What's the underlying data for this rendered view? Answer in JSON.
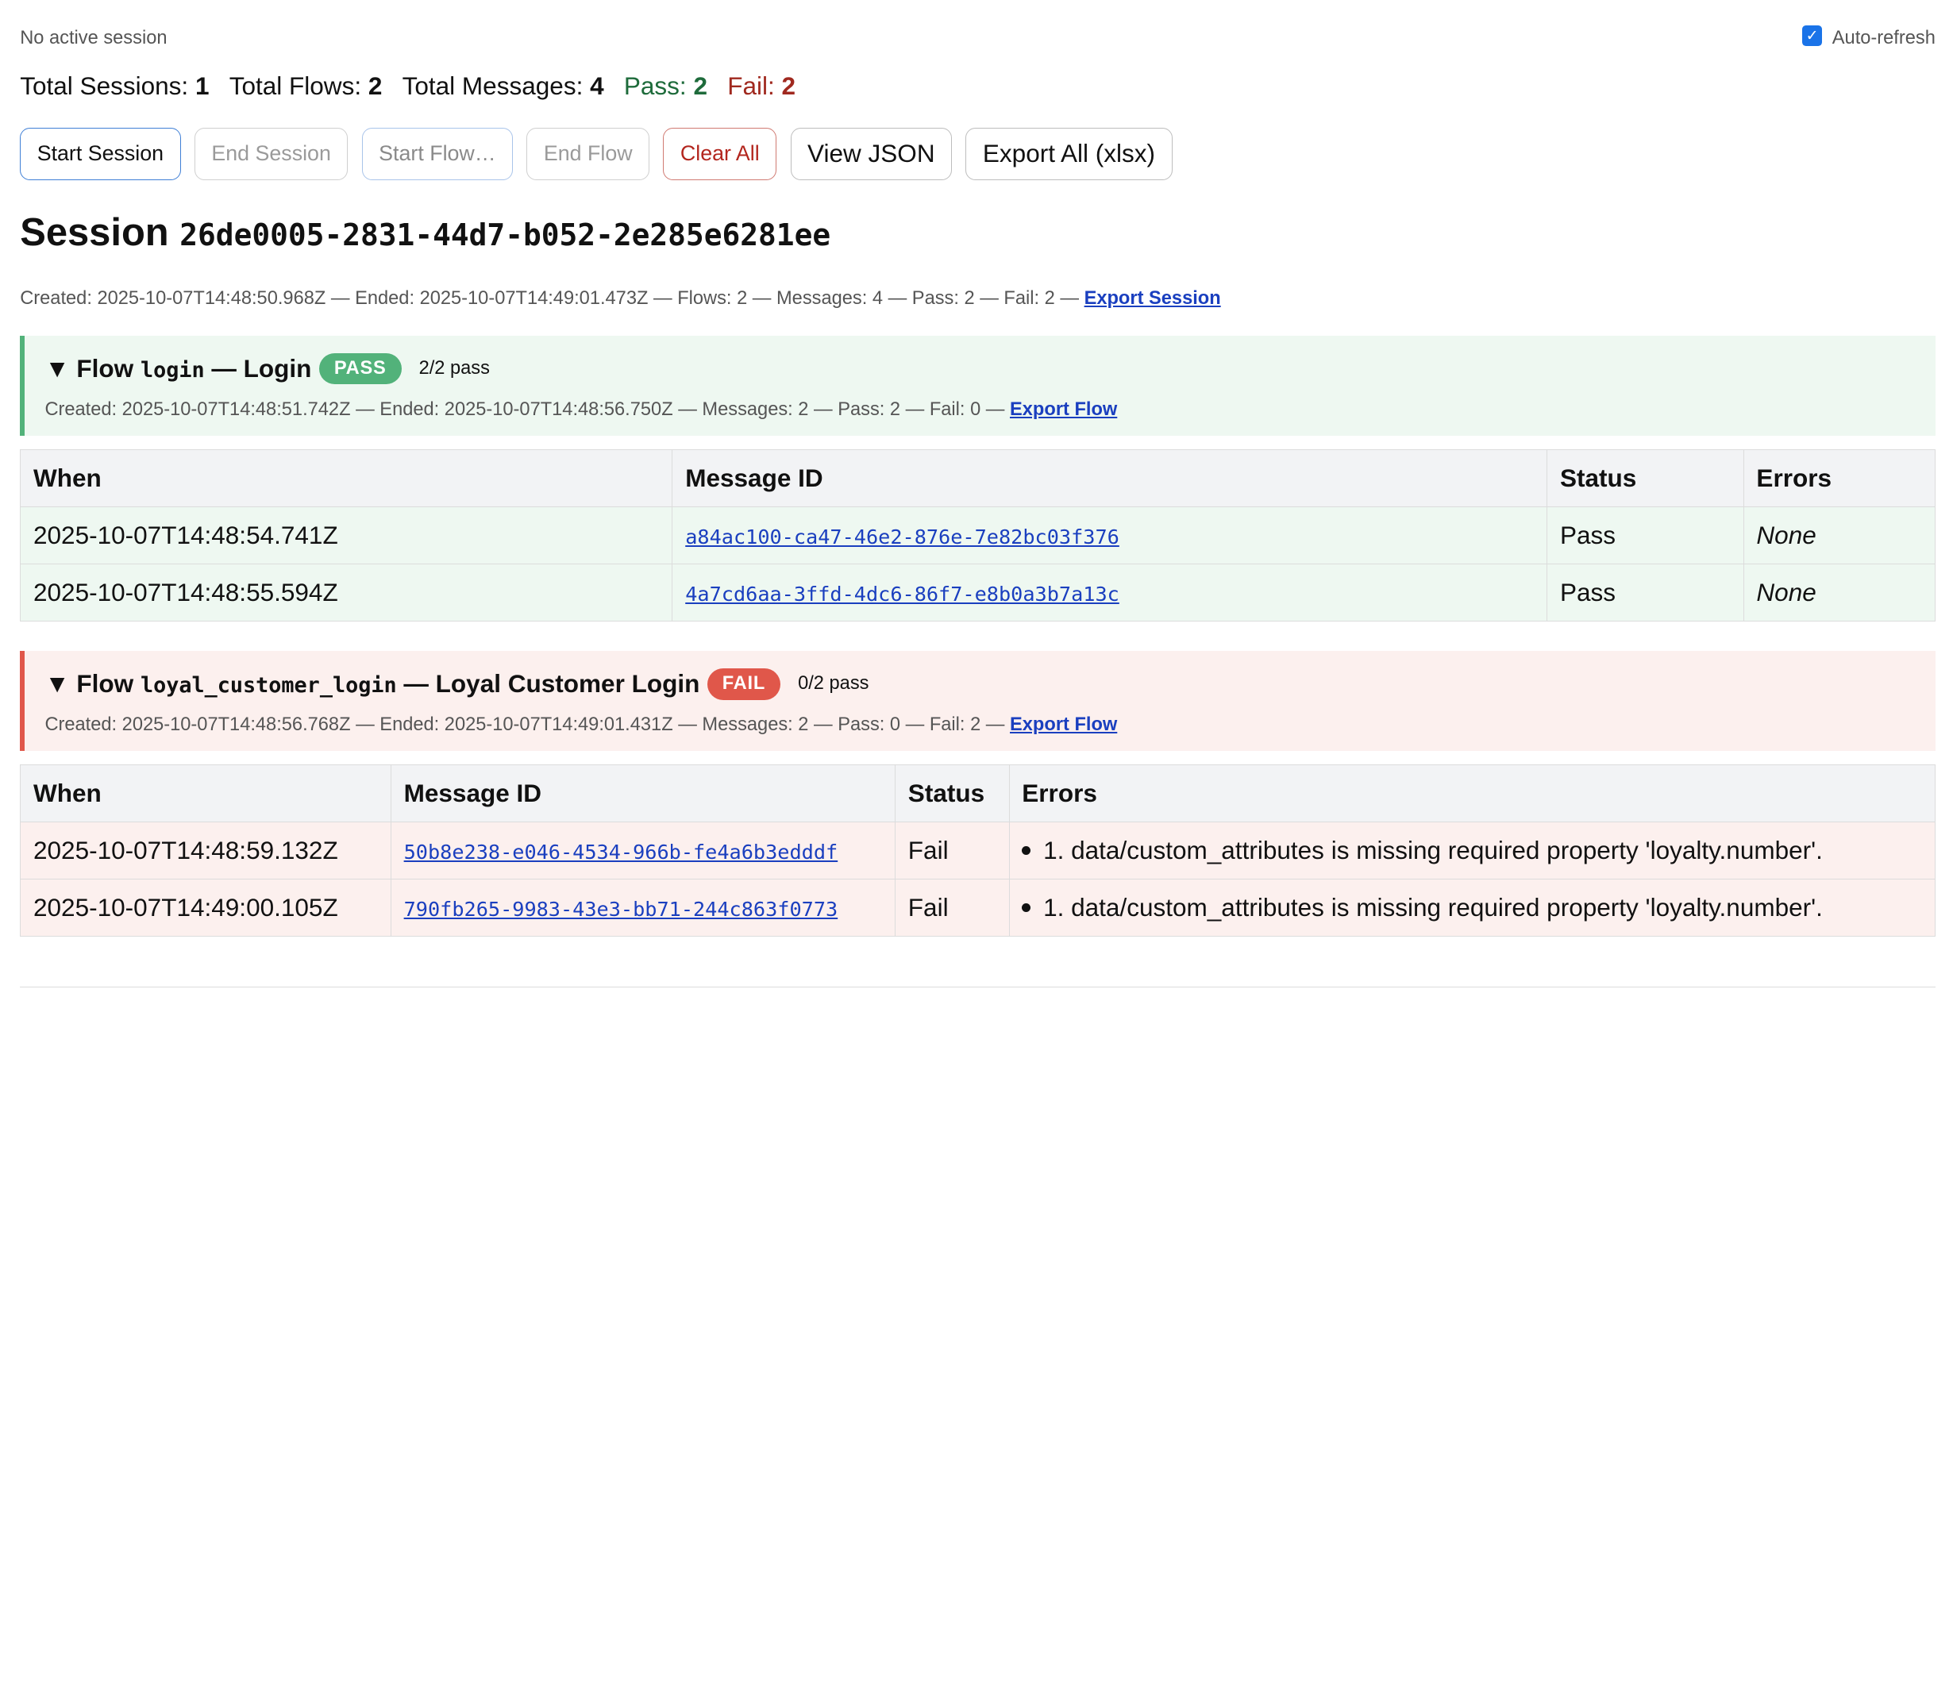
{
  "status": {
    "session": "No active session",
    "autorefresh_label": "Auto-refresh",
    "autorefresh_checked": true
  },
  "stats": {
    "sessions_label": "Total Sessions:",
    "sessions": "1",
    "flows_label": "Total Flows:",
    "flows": "2",
    "messages_label": "Total Messages:",
    "messages": "4",
    "pass_label": "Pass:",
    "pass": "2",
    "fail_label": "Fail:",
    "fail": "2"
  },
  "toolbar": {
    "start_session": "Start Session",
    "end_session": "End Session",
    "start_flow": "Start Flow…",
    "end_flow": "End Flow",
    "clear_all": "Clear All",
    "view_json": "View JSON",
    "export_all": "Export All (xlsx)"
  },
  "session": {
    "title_prefix": "Session",
    "id": "26de0005-2831-44d7-b052-2e285e6281ee",
    "meta": "Created: 2025-10-07T14:48:50.968Z — Ended: 2025-10-07T14:49:01.473Z — Flows: 2 — Messages: 4 — Pass: 2 — Fail: 2 —",
    "export_label": "Export Session"
  },
  "table_headers": {
    "when": "When",
    "message_id": "Message ID",
    "status": "Status",
    "errors": "Errors"
  },
  "flows": [
    {
      "toggle": "▼",
      "prefix": "Flow",
      "key": "login",
      "sep": "— Login",
      "badge": "PASS",
      "count": "2/2 pass",
      "meta": "Created: 2025-10-07T14:48:51.742Z — Ended: 2025-10-07T14:48:56.750Z — Messages: 2 — Pass: 2 — Fail: 0 —",
      "export_label": "Export Flow",
      "rows": [
        {
          "when": "2025-10-07T14:48:54.741Z",
          "id": "a84ac100-ca47-46e2-876e-7e82bc03f376",
          "status": "Pass",
          "errors": "None"
        },
        {
          "when": "2025-10-07T14:48:55.594Z",
          "id": "4a7cd6aa-3ffd-4dc6-86f7-e8b0a3b7a13c",
          "status": "Pass",
          "errors": "None"
        }
      ]
    },
    {
      "toggle": "▼",
      "prefix": "Flow",
      "key": "loyal_customer_login",
      "sep": "— Loyal Customer Login",
      "badge": "FAIL",
      "count": "0/2 pass",
      "meta": "Created: 2025-10-07T14:48:56.768Z — Ended: 2025-10-07T14:49:01.431Z — Messages: 2 — Pass: 0 — Fail: 2 —",
      "export_label": "Export Flow",
      "rows": [
        {
          "when": "2025-10-07T14:48:59.132Z",
          "id": "50b8e238-e046-4534-966b-fe4a6b3edddf",
          "status": "Fail",
          "errors": "1. data/custom_attributes is missing required property 'loyalty.number'."
        },
        {
          "when": "2025-10-07T14:49:00.105Z",
          "id": "790fb265-9983-43e3-bb71-244c863f0773",
          "status": "Fail",
          "errors": "1. data/custom_attributes is missing required property 'loyalty.number'."
        }
      ]
    }
  ],
  "colors": {
    "pass": "#52b27a",
    "fail": "#e0574a",
    "link": "#1a3fbf",
    "primary_border": "#3f7fd6"
  }
}
